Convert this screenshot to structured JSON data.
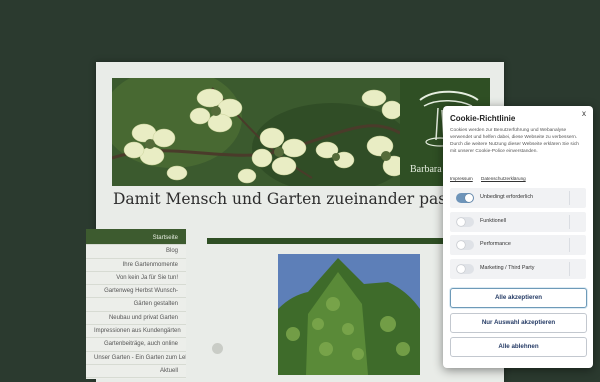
{
  "site": {
    "logo_text": "Barbara",
    "tagline": "Damit Mensch und Garten zueinander passen"
  },
  "nav": {
    "items": [
      {
        "label": "Startseite",
        "active": true
      },
      {
        "label": "Blog",
        "active": false
      },
      {
        "label": "Ihre Gartenmomente",
        "active": false
      },
      {
        "label": "Von kein Ja für Sie tun!",
        "active": false
      },
      {
        "label": "Gartenweg Herbst Wunsch-",
        "active": false
      },
      {
        "label": "Gärten gestalten",
        "active": false
      },
      {
        "label": "Neubau und privat Garten",
        "active": false
      },
      {
        "label": "Impressionen aus Kundengärten",
        "active": false
      },
      {
        "label": "Gartenbeiträge, auch online",
        "active": false
      },
      {
        "label": "Unser Garten - Ein Garten zum Leben",
        "active": false
      },
      {
        "label": "Aktuell",
        "active": false
      }
    ]
  },
  "cookie": {
    "title": "Cookie-Richtlinie",
    "close": "x",
    "description": "Cookies werden zur Benutzerführung und Webanalyse verwendet und helfen dabei, diese Webseite zu verbessern. Durch die weitere Nutzung dieser Webseite erklären Sie sich mit unserer Cookie-Police einverstanden.",
    "links": [
      "Impressum",
      "Datenschutzerklärung"
    ],
    "options": [
      {
        "label": "Unbedingt erforderlich",
        "enabled": true
      },
      {
        "label": "Funktionell",
        "enabled": false
      },
      {
        "label": "Performance",
        "enabled": false
      },
      {
        "label": "Marketing / Third Party",
        "enabled": false
      }
    ],
    "buttons": {
      "accept_all": "Alle akzeptieren",
      "accept_selection": "Nur Auswahl akzeptieren",
      "reject_all": "Alle ablehnen"
    }
  }
}
